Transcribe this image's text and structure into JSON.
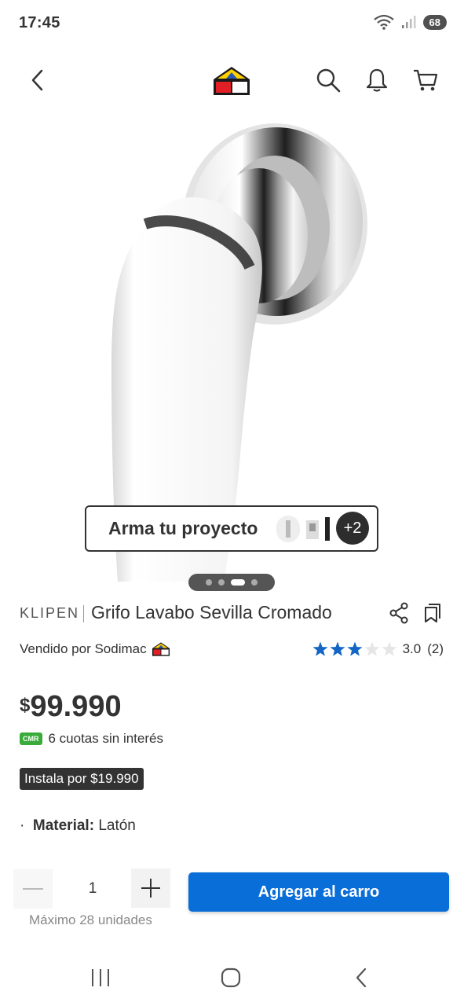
{
  "status_bar": {
    "time": "17:45",
    "battery": "68",
    "icons": [
      "wifi-icon",
      "signal-icon",
      "battery-icon"
    ]
  },
  "header": {
    "icons": [
      "back-icon",
      "sodimac-logo",
      "search-icon",
      "bell-icon",
      "cart-icon"
    ]
  },
  "carousel": {
    "arma_label": "Arma tu proyecto",
    "extra_count": "+2",
    "dots_total": 4,
    "dots_active_index": 2
  },
  "product": {
    "brand": "KLIPEN",
    "title": "Grifo Lavabo Sevilla Cromado",
    "seller": "Vendido por Sodimac",
    "rating_value": "3.0",
    "rating_count": "(2)",
    "stars_filled": 3,
    "stars_total": 5,
    "price_currency": "$",
    "price_amount": "99.990",
    "cmr_badge": "CMR",
    "installments": "6 cuotas sin interés",
    "install_offer": "Instala por $19.990",
    "material_label": "Material:",
    "material_value": "Latón"
  },
  "purchase": {
    "quantity": "1",
    "max_label": "Máximo 28 unidades",
    "add_to_cart": "Agregar al carro"
  },
  "colors": {
    "primary_blue": "#0a6ed9",
    "star_blue": "#1466c5",
    "cmr_green": "#3aab3a",
    "text_dark": "#333333"
  }
}
